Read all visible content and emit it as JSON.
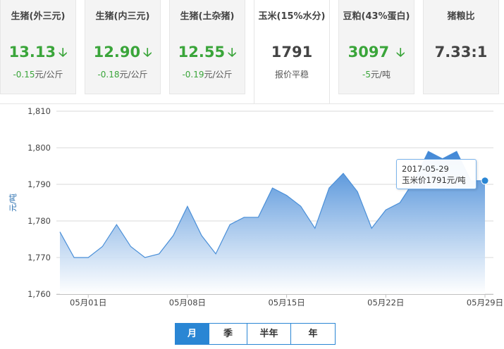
{
  "cards": [
    {
      "title": "生猪(外三元)",
      "value": "13.13",
      "trend": "down",
      "change": "-0.15",
      "unit": "元/公斤"
    },
    {
      "title": "生猪(内三元)",
      "value": "12.90",
      "trend": "down",
      "change": "-0.18",
      "unit": "元/公斤"
    },
    {
      "title": "生猪(土杂猪)",
      "value": "12.55",
      "trend": "down",
      "change": "-0.19",
      "unit": "元/公斤"
    },
    {
      "title": "玉米(15%水分)",
      "value": "1791",
      "trend": "flat",
      "change": "",
      "unit": "报价平稳"
    },
    {
      "title": "豆粕(43%蛋白)",
      "value": "3097",
      "trend": "down",
      "change": "-5",
      "unit": "元/吨"
    },
    {
      "title": "猪粮比",
      "value": "7.33:1",
      "trend": "flat",
      "change": "",
      "unit": ""
    }
  ],
  "arrow_glyph": "🡣",
  "colors": {
    "down": "#3aa53a",
    "accent": "#2a86d4",
    "area_top": "#4a90d9"
  },
  "tooltip": {
    "date": "2017-05-29",
    "text": "玉米价1791元/吨"
  },
  "period_tabs": [
    "月",
    "季",
    "半年",
    "年"
  ],
  "active_tab": 0,
  "chart_data": {
    "type": "area",
    "ylabel": "元/吨",
    "ylim": [
      1760,
      1810
    ],
    "yticks": [
      1760,
      1770,
      1780,
      1790,
      1800,
      1810
    ],
    "ytick_labels": [
      "1,760",
      "1,770",
      "1,780",
      "1,790",
      "1,800",
      "1,810"
    ],
    "xtick_labels": [
      "05月01日",
      "05月08日",
      "05月15日",
      "05月22日",
      "05月29日"
    ],
    "xtick_day_index": [
      2,
      9,
      16,
      23,
      30
    ],
    "x": [
      "04月29日",
      "04月30日",
      "05月01日",
      "05月02日",
      "05月03日",
      "05月04日",
      "05月05日",
      "05月06日",
      "05月07日",
      "05月08日",
      "05月09日",
      "05月10日",
      "05月11日",
      "05月12日",
      "05月13日",
      "05月14日",
      "05月15日",
      "05月16日",
      "05月17日",
      "05月18日",
      "05月19日",
      "05月20日",
      "05月21日",
      "05月22日",
      "05月23日",
      "05月24日",
      "05月25日",
      "05月26日",
      "05月27日",
      "05月28日",
      "05月29日"
    ],
    "values": [
      1777,
      1770,
      1770,
      1773,
      1779,
      1773,
      1770,
      1771,
      1776,
      1784,
      1776,
      1771,
      1779,
      1781,
      1781,
      1789,
      1787,
      1784,
      1778,
      1789,
      1793,
      1788,
      1778,
      1783,
      1785,
      1791,
      1799,
      1797,
      1799,
      1791,
      1791
    ],
    "grid": true,
    "legend": "none"
  }
}
